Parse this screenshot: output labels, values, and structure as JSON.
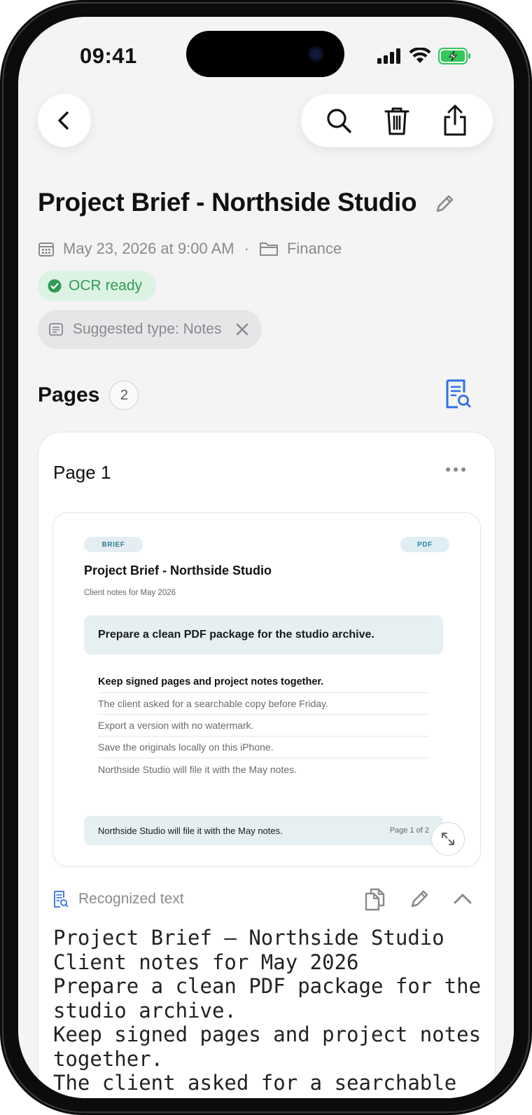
{
  "status_bar": {
    "time": "09:41"
  },
  "toolbar": {
    "back_label": "Back",
    "search_label": "Search",
    "delete_label": "Delete",
    "share_label": "Share"
  },
  "document": {
    "title": "Project Brief - Northside Studio",
    "date": "May 23, 2026 at 9:00 AM",
    "separator": "·",
    "folder": "Finance",
    "ocr_status": "OCR ready",
    "suggestion": "Suggested type: Notes"
  },
  "pages": {
    "heading": "Pages",
    "count": "2",
    "cards": [
      {
        "title": "Page 1",
        "preview": {
          "tag_left": "BRIEF",
          "tag_right": "PDF",
          "title": "Project Brief - Northside Studio",
          "subtitle": "Client notes for May 2026",
          "callout": "Prepare a clean PDF package for the studio archive.",
          "lines": [
            "Keep signed pages and project notes together.",
            "The client asked for a searchable copy before Friday.",
            "Export a version with no watermark.",
            "Save the originals locally on this iPhone.",
            "Northside Studio will file it with the May notes."
          ],
          "footer_text": "Northside Studio will file it with the May notes.",
          "footer_page": "Page 1 of 2"
        },
        "recognized_label": "Recognized text",
        "recognized_text": "Project Brief – Northside Studio\nClient notes for May 2026\nPrepare a clean PDF package for the studio archive.\nKeep signed pages and project notes together.\nThe client asked for a searchable copy before Friday."
      }
    ]
  },
  "colors": {
    "accent": "#2f6fe4",
    "ocr_green": "#2f9a55",
    "ocr_bg": "#dcf3e3",
    "screen_bg": "#f4f4f5"
  },
  "icons": {
    "back": "chevron-left-icon",
    "search": "magnifier-icon",
    "delete": "trash-icon",
    "share": "share-icon",
    "edit": "pencil-icon",
    "calendar": "calendar-icon",
    "folder": "folder-icon",
    "check": "check-circle-icon",
    "doc": "document-icon",
    "close": "close-icon",
    "doc_search": "document-search-icon",
    "more": "ellipsis-icon",
    "expand": "expand-icon",
    "copy": "copy-icon",
    "collapse": "chevron-up-icon"
  }
}
